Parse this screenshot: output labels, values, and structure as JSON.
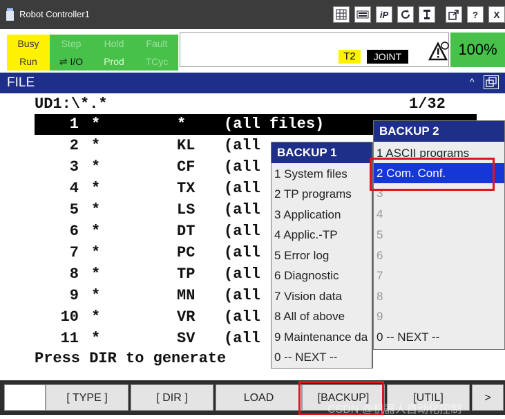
{
  "window": {
    "title": "Robot Controller1"
  },
  "toolbar": {
    "iP": "iP",
    "help": "?",
    "close": "X"
  },
  "status": {
    "busy": "Busy",
    "step": "Step",
    "hold": "Hold",
    "fault": "Fault",
    "run": "Run",
    "io": "I/O",
    "prod": "Prod",
    "tcyc": "TCyc",
    "mode": "T2",
    "coord": "JOINT",
    "override": "100%"
  },
  "file_screen": {
    "title": "FILE",
    "path": "UD1:\\*.*",
    "page": "1/32",
    "rows": [
      {
        "num": "1",
        "star": "*",
        "ext": "*",
        "desc": "(all files)"
      },
      {
        "num": "2",
        "star": "*",
        "ext": "KL",
        "desc": "(all"
      },
      {
        "num": "3",
        "star": "*",
        "ext": "CF",
        "desc": "(all"
      },
      {
        "num": "4",
        "star": "*",
        "ext": "TX",
        "desc": "(all"
      },
      {
        "num": "5",
        "star": "*",
        "ext": "LS",
        "desc": "(all"
      },
      {
        "num": "6",
        "star": "*",
        "ext": "DT",
        "desc": "(all"
      },
      {
        "num": "7",
        "star": "*",
        "ext": "PC",
        "desc": "(all"
      },
      {
        "num": "8",
        "star": "*",
        "ext": "TP",
        "desc": "(all"
      },
      {
        "num": "9",
        "star": "*",
        "ext": "MN",
        "desc": "(all"
      },
      {
        "num": "10",
        "star": "*",
        "ext": "VR",
        "desc": "(all"
      },
      {
        "num": "11",
        "star": "*",
        "ext": "SV",
        "desc": "(all"
      }
    ],
    "hint": "Press DIR to generate"
  },
  "backup1": {
    "title": "BACKUP   1",
    "items": [
      "1 System files",
      "2 TP programs",
      "3 Application",
      "4 Applic.-TP",
      "5 Error log",
      "6 Diagnostic",
      "7 Vision data",
      "8 All of above",
      "9 Maintenance da",
      "0 -- NEXT --"
    ]
  },
  "backup2": {
    "title": "BACKUP   2",
    "items": [
      "1 ASCII programs",
      "2 Com. Conf.",
      "3",
      "4",
      "5",
      "6",
      "7",
      "8",
      "9",
      "0 -- NEXT --"
    ]
  },
  "function_keys": {
    "f1": "[ TYPE ]",
    "f2": "[ DIR ]",
    "f3": "LOAD",
    "f4": "[BACKUP]",
    "f5": "[UTIL]",
    "next": ">"
  },
  "watermark": "CSDN @机器人自动化控制"
}
